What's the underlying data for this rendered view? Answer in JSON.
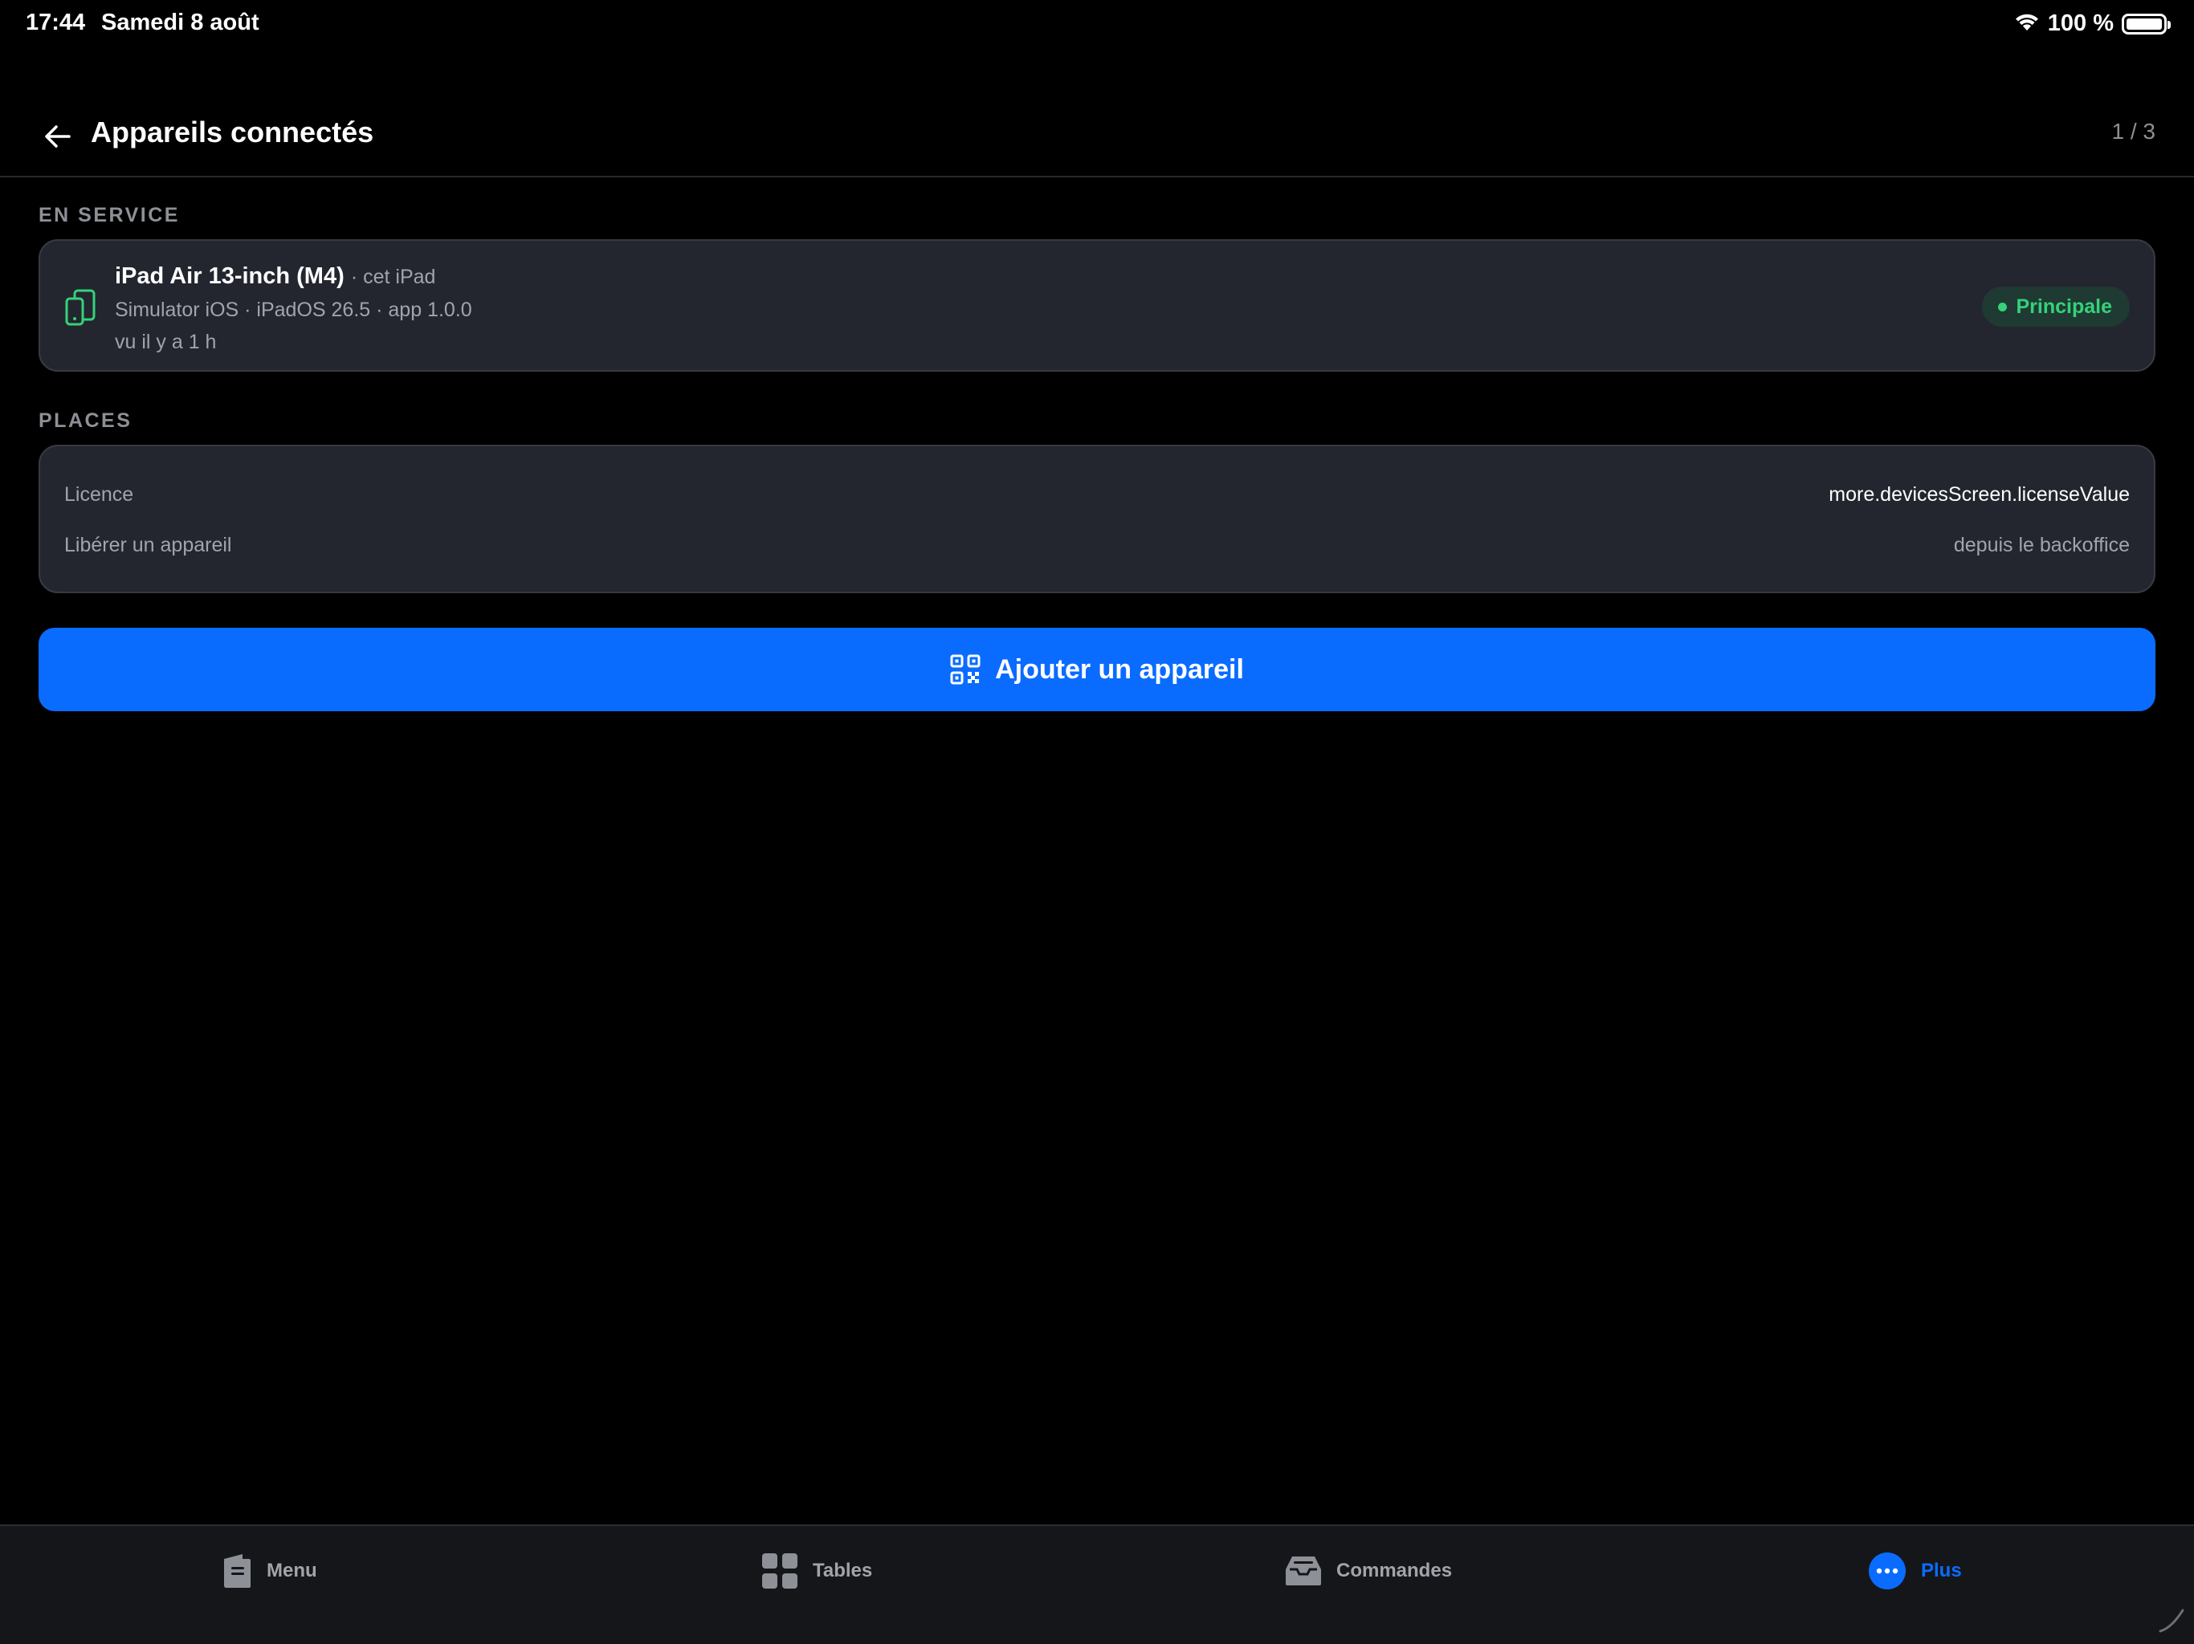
{
  "status_bar": {
    "time": "17:44",
    "date": "Samedi 8 août",
    "battery_text": "100 %",
    "icons": [
      "wifi-icon",
      "battery-icon"
    ]
  },
  "header": {
    "title": "Appareils connectés",
    "counter": "1 / 3",
    "back_icon": "arrow-left-icon"
  },
  "in_service": {
    "section_label": "EN SERVICE",
    "device": {
      "name": "iPad Air 13-inch (M4)",
      "this_device": "· cet iPad",
      "meta": "Simulator iOS · iPadOS 26.5 · app 1.0.0",
      "last_seen": "vu il y a 1 h",
      "badge": "Principale",
      "icon": "devices-icon"
    }
  },
  "places": {
    "section_label": "PLACES",
    "rows": [
      {
        "label": "Licence",
        "value": "more.devicesScreen.licenseValue"
      },
      {
        "label": "Libérer un appareil",
        "value": "depuis le backoffice"
      }
    ]
  },
  "add_button": {
    "label": "Ajouter un appareil",
    "icon": "qr-code-icon"
  },
  "tabbar": {
    "tabs": [
      {
        "label": "Menu",
        "icon": "menu-book-icon",
        "active": false
      },
      {
        "label": "Tables",
        "icon": "grid-icon",
        "active": false
      },
      {
        "label": "Commandes",
        "icon": "inbox-icon",
        "active": false
      },
      {
        "label": "Plus",
        "icon": "more-dots-icon",
        "active": true
      }
    ]
  },
  "colors": {
    "accent": "#0a6cff",
    "success": "#34d27a",
    "card_bg": "#23262e",
    "background": "#000000"
  }
}
